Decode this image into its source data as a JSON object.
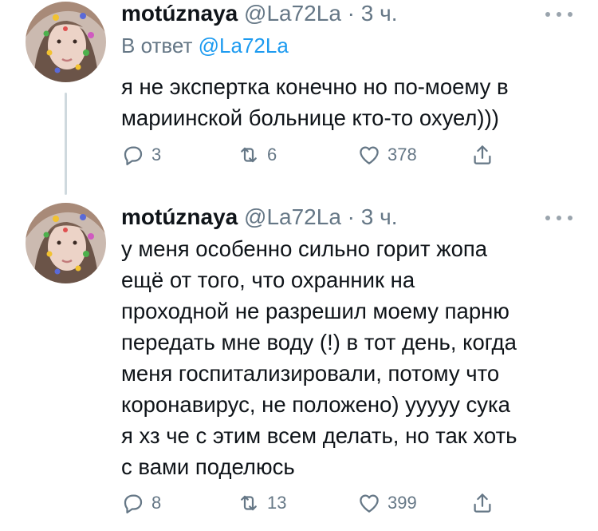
{
  "tweets": [
    {
      "name": "motúznaya",
      "handle": "@La72La",
      "sep": "·",
      "time": "3 ч.",
      "reply_prefix": "В ответ ",
      "reply_handle": "@La72La",
      "text": "я не экспертка конечно но по-моему в\nмариинской больнице кто-то охуел)))",
      "replies": "3",
      "retweets": "6",
      "likes": "378"
    },
    {
      "name": "motúznaya",
      "handle": "@La72La",
      "sep": "·",
      "time": "3 ч.",
      "text": "у меня особенно сильно горит жопа\nещё от того, что охранник на\nпроходной не разрешил моему парню\nпередать мне воду (!) в тот день, когда\nменя госпитализировали, потому что\nкоронавирус, не положено) ууууу сука\nя хз че с этим всем делать, но так хоть\nс вами поделюсь",
      "replies": "8",
      "retweets": "13",
      "likes": "399"
    }
  ],
  "icons": {
    "reply": "reply-icon",
    "retweet": "retweet-icon",
    "like": "heart-icon",
    "share": "share-icon",
    "more": "more-icon"
  },
  "colors": {
    "text": "#0f1419",
    "secondary": "#657786",
    "link": "#1d9bf0"
  }
}
